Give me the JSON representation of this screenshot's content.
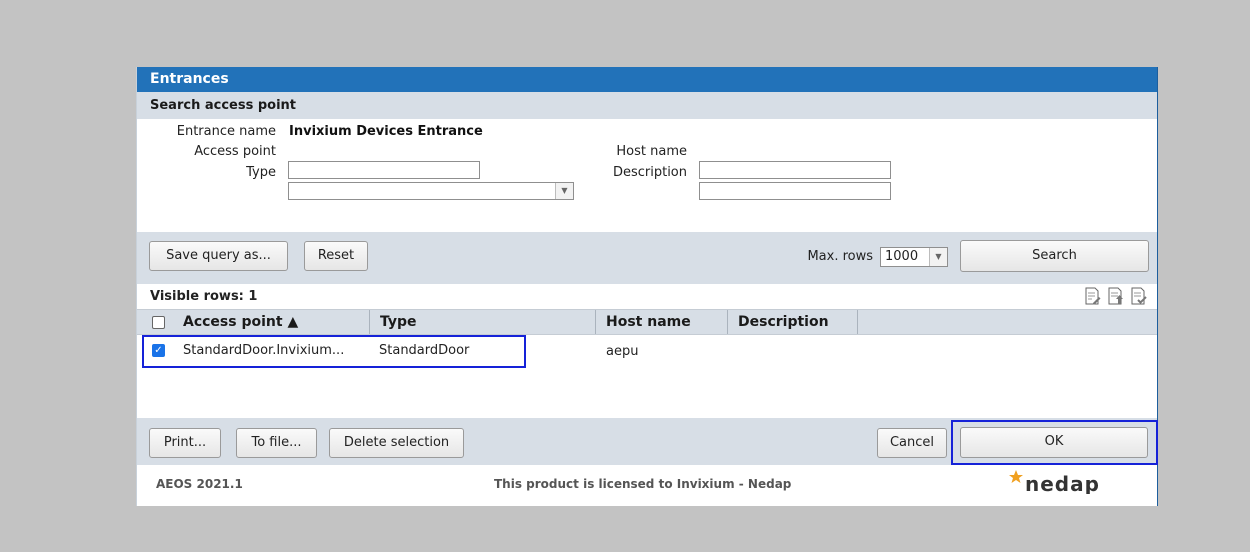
{
  "dialog": {
    "title": "Entrances",
    "section_title": "Search access point",
    "form": {
      "entrance_name_label": "Entrance name",
      "entrance_name_value": "Invixium Devices Entrance",
      "access_point_label": "Access point",
      "access_point_value": "",
      "type_label": "Type",
      "type_value": "",
      "host_name_label": "Host name",
      "host_name_value": "",
      "description_label": "Description",
      "description_value": ""
    },
    "toolbar": {
      "save_query_label": "Save query as...",
      "reset_label": "Reset",
      "max_rows_label": "Max. rows",
      "max_rows_value": "1000",
      "search_label": "Search"
    },
    "visible_rows_text": "Visible rows: 1",
    "table": {
      "columns": [
        "Access point ▲",
        "Type",
        "Host name",
        "Description"
      ],
      "rows": [
        {
          "checked": true,
          "access_point": "StandardDoor.Invixium...",
          "type": "StandardDoor",
          "host_name": "aepu",
          "description": ""
        }
      ]
    },
    "footer": {
      "print_label": "Print...",
      "to_file_label": "To file...",
      "delete_selection_label": "Delete selection",
      "cancel_label": "Cancel",
      "ok_label": "OK"
    },
    "status": {
      "version": "AEOS 2021.1",
      "license": "This product is licensed to Invixium - Nedap",
      "logo_text": "nedap"
    }
  },
  "colors": {
    "title_bar": "#2272b9",
    "section_bg": "#d7dee6",
    "highlight": "#1522d8",
    "logo_star": "#f0a020"
  }
}
